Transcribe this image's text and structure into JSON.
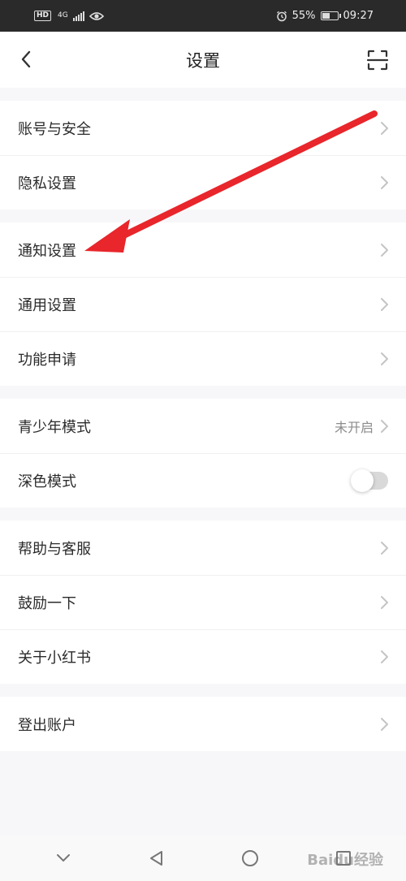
{
  "status_bar": {
    "hd": "HD",
    "network": "4G",
    "battery_percent": "55%",
    "battery_level": 0.55,
    "time": "09:27"
  },
  "header": {
    "title": "设置",
    "back_icon": "chevron-left-icon",
    "scan_icon": "scan-icon"
  },
  "groups": [
    {
      "items": [
        {
          "label": "账号与安全"
        },
        {
          "label": "隐私设置"
        }
      ]
    },
    {
      "items": [
        {
          "label": "通知设置"
        },
        {
          "label": "通用设置"
        },
        {
          "label": "功能申请"
        }
      ]
    },
    {
      "items": [
        {
          "label": "青少年模式",
          "value": "未开启"
        },
        {
          "label": "深色模式",
          "toggle": false
        }
      ]
    },
    {
      "items": [
        {
          "label": "帮助与客服"
        },
        {
          "label": "鼓励一下"
        },
        {
          "label": "关于小红书"
        }
      ]
    },
    {
      "items": [
        {
          "label": "登出账户"
        }
      ]
    }
  ],
  "annotation": {
    "color": "#e8262b",
    "points_to": "通知设置"
  },
  "nav_bar": {
    "buttons": [
      "chevron-down-icon",
      "back-triangle-icon",
      "home-circle-icon",
      "recents-square-icon"
    ]
  },
  "watermark": "Baidu经验"
}
